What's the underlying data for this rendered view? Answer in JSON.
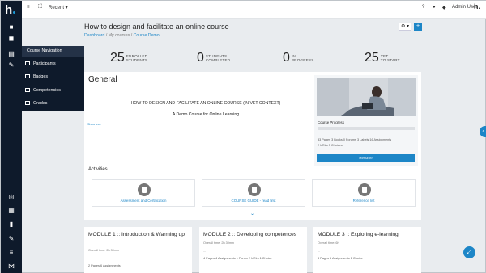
{
  "brand": {
    "logo_text": "h"
  },
  "topbar": {
    "recent_label": "Recent",
    "user_name": "Admin User",
    "avatar_text": "h."
  },
  "course_nav": {
    "header": "Course Navigation",
    "items": [
      {
        "label": "Participants"
      },
      {
        "label": "Badges"
      },
      {
        "label": "Competencies"
      },
      {
        "label": "Grades"
      }
    ]
  },
  "header": {
    "title": "How to design and facilitate an online course",
    "breadcrumb": [
      "Dashboard",
      "My courses",
      "Course Demo"
    ],
    "gear_symbol": "⚙ ▾",
    "add_symbol": "+"
  },
  "stats": [
    {
      "number": "25",
      "label_line1": "ENROLLED",
      "label_line2": "STUDENTS"
    },
    {
      "number": "0",
      "label_line1": "STUDENTS",
      "label_line2": "COMPLETED"
    },
    {
      "number": "0",
      "label_line1": "IN",
      "label_line2": "PROGRESS"
    },
    {
      "number": "25",
      "label_line1": "YET",
      "label_line2": "TO START"
    }
  ],
  "general": {
    "title": "General",
    "heading": "HOW TO DESIGN AND FACILITATE AN ONLINE COURSE (IN VET CONTEXT)",
    "subheading": "A Demo Course for Online Learning",
    "show_less": "Show less"
  },
  "course_progress": {
    "label": "Course Progress",
    "progress_fraction": 0.0,
    "line1": "33 Pages   3 Books   0 Forums   3 Labels   16 Assignments",
    "line2": "2 URLs   3 Choices",
    "resume_label": "Resume"
  },
  "activities": {
    "heading": "Activities",
    "items": [
      {
        "label": "Assessment and Certification"
      },
      {
        "label": "COURSE GUIDE - read first"
      },
      {
        "label": "Reference list"
      }
    ]
  },
  "modules": [
    {
      "title": "MODULE 1 :: Introduction & Warming up",
      "duration": "Overall time: 2h 30min",
      "dash": "...",
      "stats": "2 Pages   6 Assignments"
    },
    {
      "title": "MODULE 2 :: Developing competences",
      "duration": "Overall time: 2h 30min",
      "dash": "...",
      "stats": "4 Pages   4 Assignments   1 Forum   2 URLs   1 Choice"
    },
    {
      "title": "MODULE 3 :: Exploring e-learning",
      "duration": "Overall time: 6h",
      "dash": "...",
      "stats": "3 Pages   6 Assignments   1 Choice"
    }
  ],
  "colors": {
    "accent": "#1d86c7",
    "sidebar": "#0e1a2b"
  }
}
